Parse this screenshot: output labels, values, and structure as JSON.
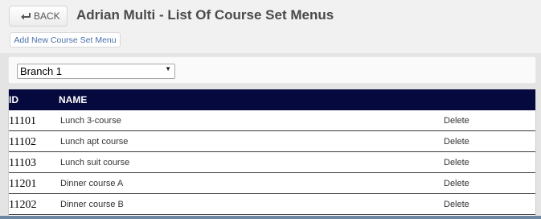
{
  "header": {
    "back_label": "BACK",
    "title": "Adrian Multi - List Of Course Set Menus",
    "add_label": "Add New Course Set Menu"
  },
  "filter": {
    "branch_selected": "Branch 1"
  },
  "table": {
    "columns": [
      "ID",
      "NAME"
    ],
    "rows": [
      {
        "id": "11101",
        "name": "Lunch 3-course",
        "action": "Delete"
      },
      {
        "id": "11102",
        "name": "Lunch apt course",
        "action": "Delete"
      },
      {
        "id": "11103",
        "name": "Lunch suit course",
        "action": "Delete"
      },
      {
        "id": "11201",
        "name": "Dinner course A",
        "action": "Delete"
      },
      {
        "id": "11202",
        "name": "Dinner course B",
        "action": "Delete"
      }
    ]
  },
  "icons": {
    "back": "back-arrow-icon",
    "select": "dropdown-arrow-icon"
  },
  "colors": {
    "table_header_bg": "#06093d",
    "link": "#4a6fa8"
  }
}
